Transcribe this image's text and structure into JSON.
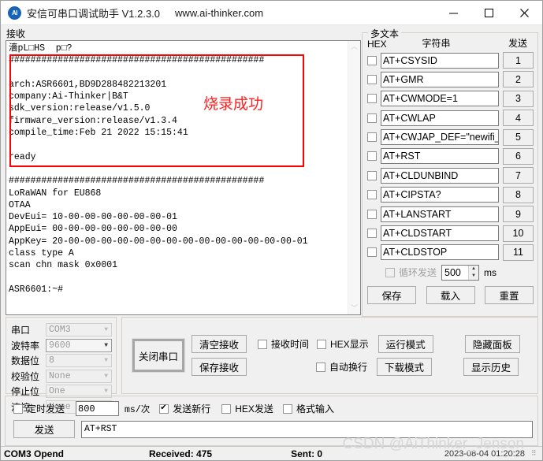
{
  "titlebar": {
    "icon_label": "AI",
    "title": "安信可串口调试助手 V1.2.3.0",
    "url": "www.ai-thinker.com",
    "minimize": "—",
    "maximize": "□",
    "close": "✕"
  },
  "receive": {
    "group_label": "接收",
    "text": "濇pL□HS  p□?\n###############################################\n\narch:ASR6601,BD9D288482213201\ncompany:Ai-Thinker|B&T\nsdk_version:release/v1.5.0\nfirmware_version:release/v1.3.4\ncompile_time:Feb 21 2022 15:15:41\n\nready\n\n###############################################\nLoRaWAN for EU868\nOTAA\nDevEui= 10-00-00-00-00-00-00-01\nAppEui= 00-00-00-00-00-00-00-00\nAppKey= 20-00-00-00-00-00-00-00-00-00-00-00-00-00-00-01\nclass type A\nscan chn mask 0x0001\n\nASR6601:~#",
    "annotation": "烧录成功",
    "annotation_color": "#ff2020",
    "highlight_color": "#ff0000",
    "scroll_up": "︿",
    "scroll_down": "﹀"
  },
  "multitext": {
    "group_label": "多文本",
    "header_hex": "HEX",
    "header_string": "字符串",
    "header_send": "发送",
    "rows": [
      {
        "command": "AT+CSYSID",
        "send": "1",
        "hex_checked": false
      },
      {
        "command": "AT+GMR",
        "send": "2",
        "hex_checked": false
      },
      {
        "command": "AT+CWMODE=1",
        "send": "3",
        "hex_checked": false
      },
      {
        "command": "AT+CWLAP",
        "send": "4",
        "hex_checked": false
      },
      {
        "command": "AT+CWJAP_DEF=\"newifi_",
        "send": "5",
        "hex_checked": false
      },
      {
        "command": "AT+RST",
        "send": "6",
        "hex_checked": false
      },
      {
        "command": "AT+CLDUNBIND",
        "send": "7",
        "hex_checked": false
      },
      {
        "command": "AT+CIPSTA?",
        "send": "8",
        "hex_checked": false
      },
      {
        "command": "AT+LANSTART",
        "send": "9",
        "hex_checked": false
      },
      {
        "command": "AT+CLDSTART",
        "send": "10",
        "hex_checked": false
      },
      {
        "command": "AT+CLDSTOP",
        "send": "11",
        "hex_checked": false
      }
    ],
    "loop_label": "循环发送",
    "loop_value": "500",
    "loop_unit": "ms",
    "save": "保存",
    "load": "载入",
    "reset": "重置"
  },
  "port": {
    "labels": {
      "port": "串口",
      "baud": "波特率",
      "databits": "数据位",
      "parity": "校验位",
      "stopbits": "停止位",
      "flow": "流控"
    },
    "values": {
      "port": "COM3",
      "baud": "9600",
      "databits": "8",
      "parity": "None",
      "stopbits": "One",
      "flow": "None"
    }
  },
  "operations": {
    "close_port": "关闭串口",
    "clear_recv": "清空接收",
    "save_recv": "保存接收",
    "recv_time": "接收时间",
    "hex_display": "HEX显示",
    "auto_newline": "自动换行",
    "run_mode": "运行模式",
    "download_mode": "下载模式",
    "hide_panel": "隐藏面板",
    "show_history": "显示历史",
    "recv_time_checked": false,
    "hex_display_checked": false,
    "auto_newline_checked": false
  },
  "send": {
    "timed_label": "定时发送",
    "timed_checked": false,
    "interval": "800",
    "interval_unit": "ms/次",
    "newline_label": "发送新行",
    "newline_checked": true,
    "hex_label": "HEX发送",
    "hex_checked": false,
    "format_label": "格式输入",
    "format_checked": false,
    "send_button": "发送",
    "input_value": "AT+RST"
  },
  "status": {
    "connection": "COM3 Opend",
    "received": "Received: 475",
    "sent": "Sent: 0",
    "timestamp": "2023-08-04 01:20:28",
    "watermark": "CSDN @AiThinker_Jenson"
  }
}
